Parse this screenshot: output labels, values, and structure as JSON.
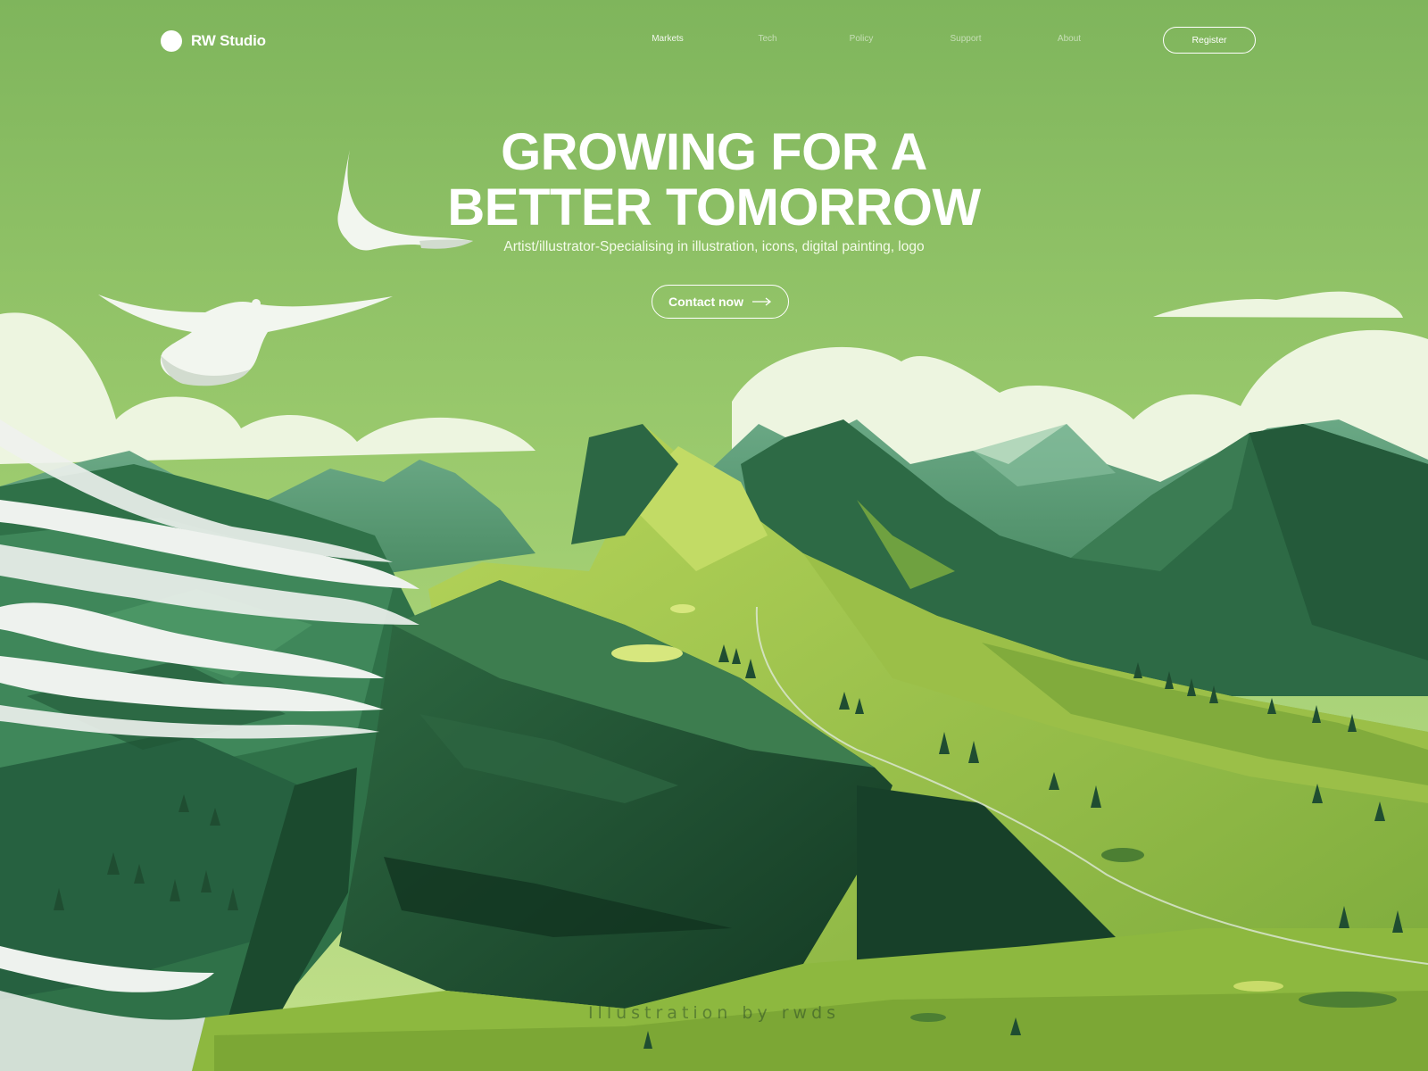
{
  "brand": {
    "name": "RW Studio"
  },
  "nav": {
    "items": [
      {
        "label": "Markets",
        "active": true
      },
      {
        "label": "Tech",
        "active": false
      },
      {
        "label": "Policy",
        "active": false
      },
      {
        "label": "Support",
        "active": false
      },
      {
        "label": "About",
        "active": false
      }
    ],
    "register_label": "Register"
  },
  "hero": {
    "title_line1": "GROWING FOR A",
    "title_line2": "BETTER TOMORROW",
    "subtitle": "Artist/illustrator-Specialising in illustration, icons, digital painting, logo",
    "cta_label": "Contact now",
    "cta_icon": "arrow-right-icon"
  },
  "credit": "Illustration by rwds",
  "colors": {
    "sky_top": "#7fb55c",
    "sky_bottom": "#b4d97e",
    "cloud": "#eef6e1",
    "grass_light": "#a7c94c",
    "grass_mid": "#7fae3f",
    "forest": "#3f7d4e",
    "rock_dark": "#1f4d31",
    "mist": "#e9efe9"
  }
}
